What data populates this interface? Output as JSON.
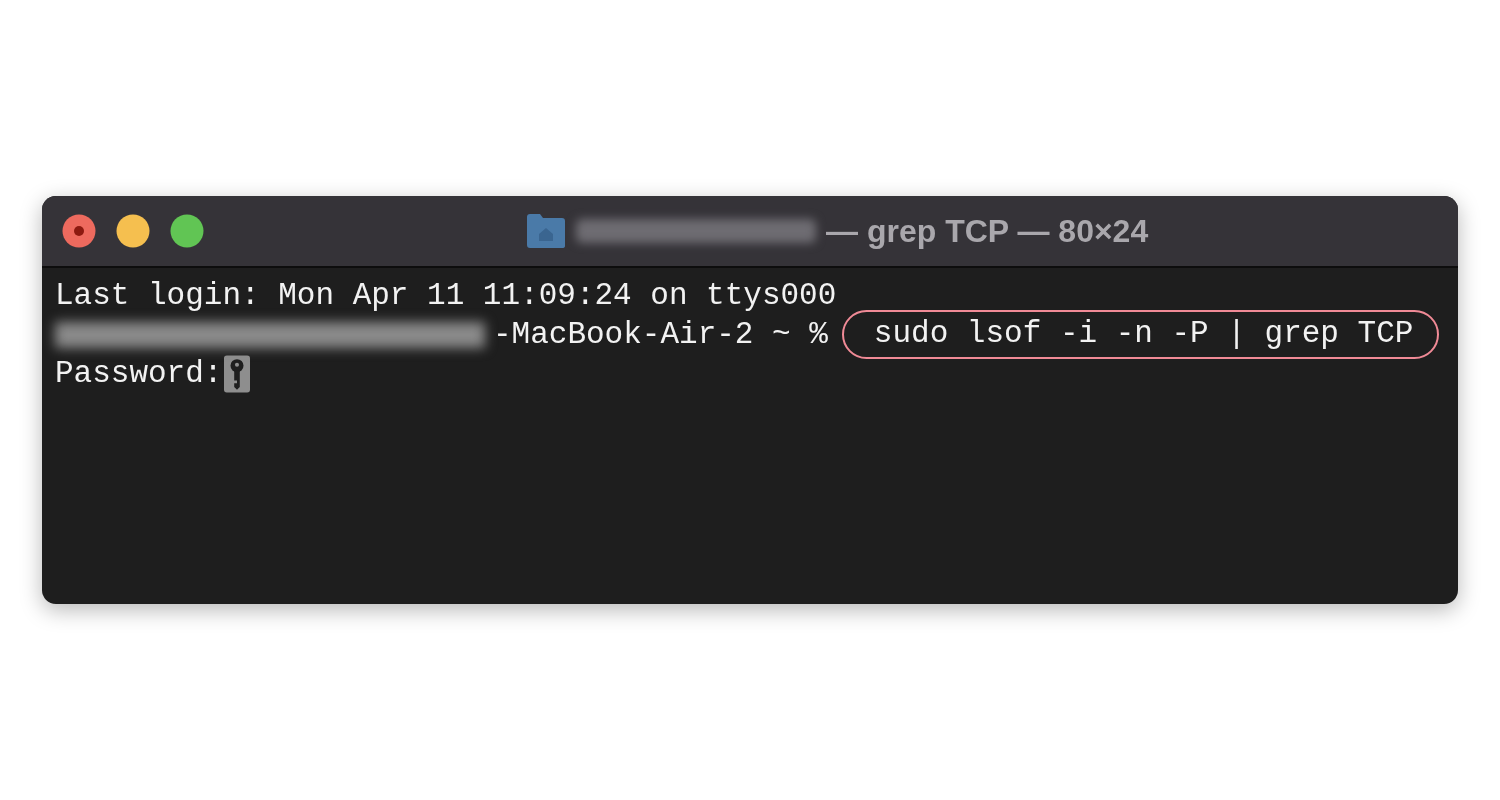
{
  "window": {
    "title": "— grep TCP — 80×24",
    "buttons": [
      {
        "kind": "close"
      },
      {
        "kind": "minimize"
      },
      {
        "kind": "zoom"
      }
    ]
  },
  "terminal": {
    "lines": [
      {
        "kind": "output",
        "text": "Last login: Mon Apr 11 11:09:24 on ttys000"
      },
      {
        "kind": "prompt",
        "prompt": "-MacBook-Air-2 ~ %",
        "command": "sudo lsof -i -n -P | grep TCP",
        "highlighted": true
      },
      {
        "kind": "password",
        "text": "Password:"
      }
    ]
  }
}
